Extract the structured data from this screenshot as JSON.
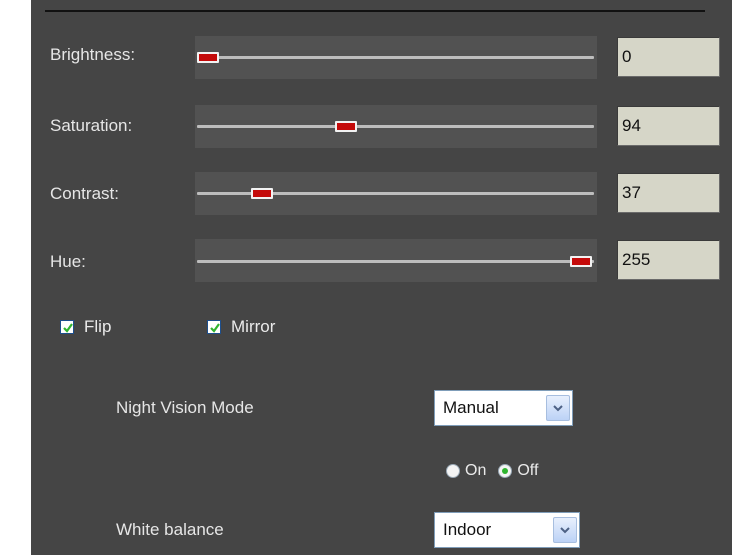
{
  "sliders": [
    {
      "label": "Brightness:",
      "value": "0",
      "level": 0.03
    },
    {
      "label": "Saturation:",
      "value": "94",
      "level": 0.37
    },
    {
      "label": "Contrast:",
      "value": "37",
      "level": 0.15
    },
    {
      "label": "Hue:",
      "value": "255",
      "level": 0.97
    }
  ],
  "checkboxes": {
    "flip": {
      "label": "Flip",
      "checked": true
    },
    "mirror": {
      "label": "Mirror",
      "checked": true
    }
  },
  "night_vision": {
    "label": "Night Vision Mode",
    "selected": "Manual",
    "radio_on": "On",
    "radio_off": "Off",
    "radio_selected": "Off"
  },
  "white_balance": {
    "label": "White balance",
    "selected": "Indoor"
  },
  "colors": {
    "panel_bg": "#454545",
    "thumb": "#c40a0a",
    "value_box": "#d6d6c8",
    "check_green": "#2fb42f"
  }
}
